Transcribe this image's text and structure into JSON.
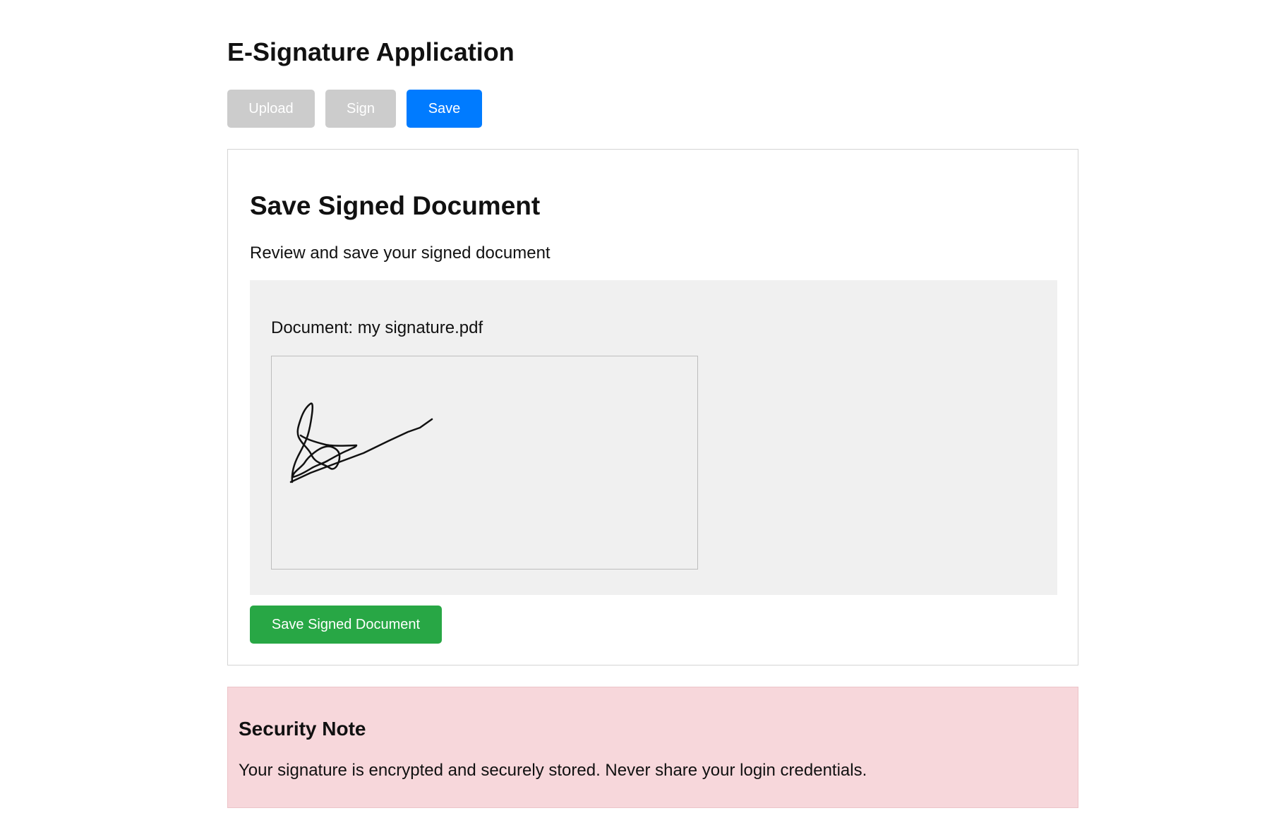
{
  "app": {
    "title": "E-Signature Application"
  },
  "steps": [
    {
      "label": "Upload",
      "active": false
    },
    {
      "label": "Sign",
      "active": false
    },
    {
      "label": "Save",
      "active": true
    }
  ],
  "panel": {
    "title": "Save Signed Document",
    "description": "Review and save your signed document",
    "document_label": "Document: my signature.pdf",
    "save_button_label": "Save Signed Document"
  },
  "security_note": {
    "title": "Security Note",
    "text": "Your signature is encrypted and securely stored. Never share your login credentials."
  },
  "colors": {
    "active_step": "#007bff",
    "inactive_step": "#cccccc",
    "save_button": "#28a745",
    "security_background": "#f7d7db",
    "preview_background": "#f0f0f0"
  }
}
